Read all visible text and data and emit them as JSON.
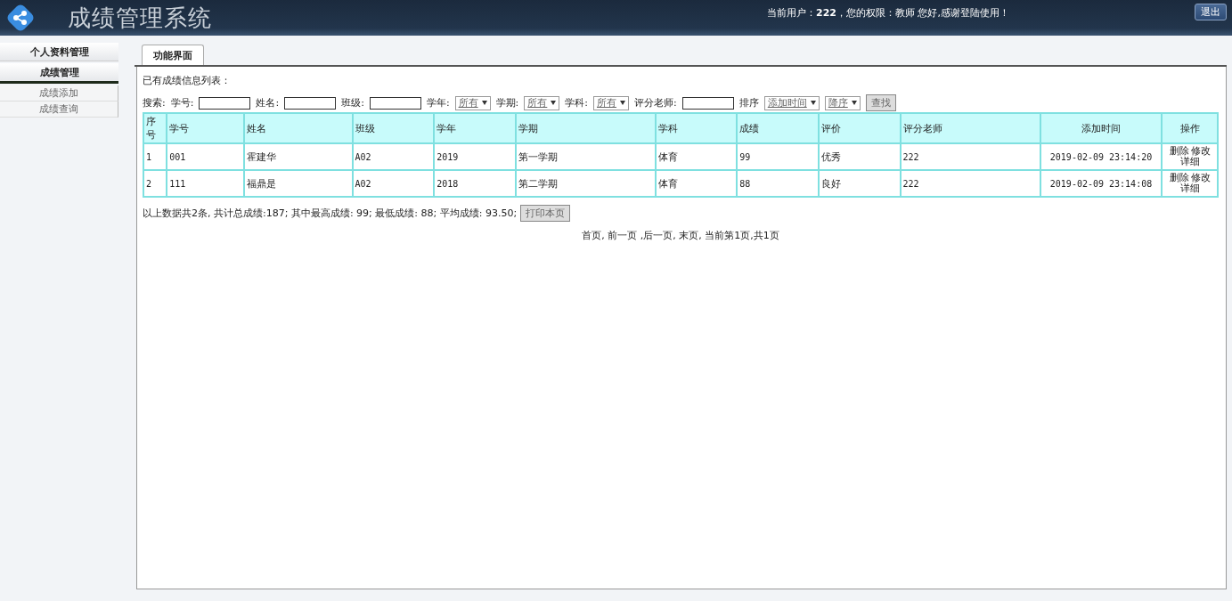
{
  "header": {
    "title": "成绩管理系统",
    "greeting": "当前用户：**222**，您的权限：教师 您好,感谢登陆使用！",
    "logout": "退出"
  },
  "sidebar": {
    "groups": [
      {
        "label": "个人资料管理",
        "expanded": false
      },
      {
        "label": "成绩管理",
        "expanded": true,
        "children": [
          {
            "label": "成绩添加"
          },
          {
            "label": "成绩查询"
          }
        ]
      }
    ]
  },
  "tabs": [
    {
      "label": "功能界面",
      "selected": true
    }
  ],
  "list_title": "已有成绩信息列表：",
  "search": {
    "label": "搜索:",
    "fields": [
      {
        "kind": "input",
        "label": "学号:"
      },
      {
        "kind": "input",
        "label": "姓名:"
      },
      {
        "kind": "input",
        "label": "班级:"
      },
      {
        "kind": "select",
        "label": "学年:",
        "value": "所有"
      },
      {
        "kind": "select",
        "label": "学期:",
        "value": "所有"
      },
      {
        "kind": "select",
        "label": "学科:",
        "value": "所有"
      },
      {
        "kind": "input",
        "label": "评分老师:"
      },
      {
        "kind": "select",
        "label": "排序",
        "value": "添加时间"
      },
      {
        "kind": "select",
        "value": "降序"
      }
    ],
    "button": "查找"
  },
  "table": {
    "columns": [
      "序号",
      "学号",
      "姓名",
      "班级",
      "学年",
      "学期",
      "学科",
      "成绩",
      "评价",
      "评分老师",
      "添加时间",
      "操作"
    ],
    "rows": [
      {
        "cells": [
          "1",
          "001",
          "霍建华",
          "A02",
          "2019",
          "第一学期",
          "体育",
          "99",
          "优秀",
          "222",
          "2019-02-09 23:14:20"
        ],
        "actions": [
          "删除",
          "修改",
          "详细"
        ]
      },
      {
        "cells": [
          "2",
          "111",
          "福鼎是",
          "A02",
          "2018",
          "第二学期",
          "体育",
          "88",
          "良好",
          "222",
          "2019-02-09 23:14:08"
        ],
        "actions": [
          "删除",
          "修改",
          "详细"
        ]
      }
    ]
  },
  "summary": "以上数据共2条, 共计总成绩:187;  其中最高成绩: 99; 最低成绩: 88; 平均成绩: 93.50;",
  "print_button": "打印本页",
  "pager": "首页, 前一页 ,后一页, 末页, 当前第1页,共1页"
}
